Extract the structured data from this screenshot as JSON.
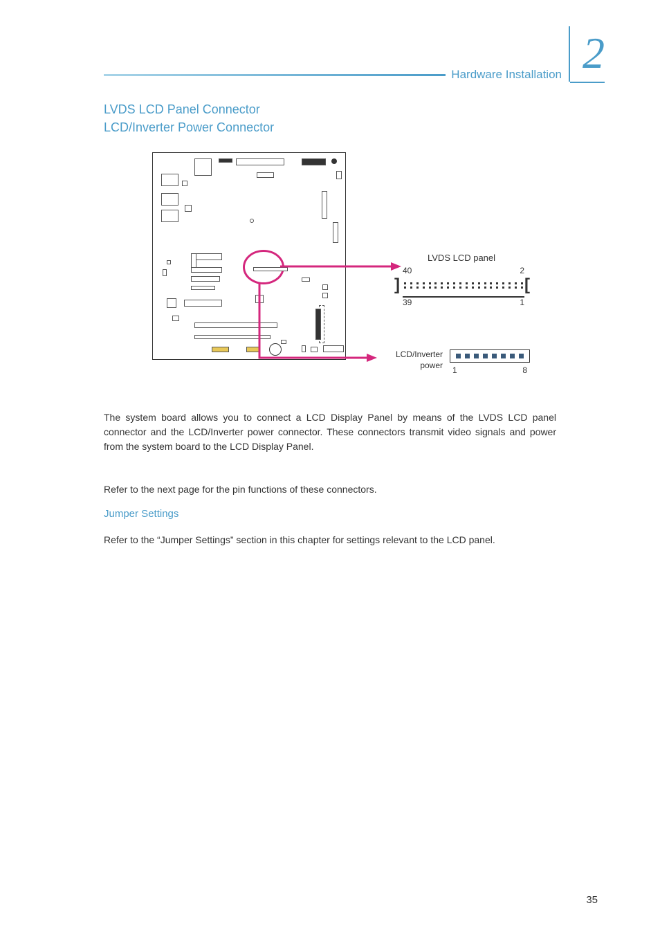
{
  "chapter": {
    "number": "2",
    "header_title": "Hardware Installation"
  },
  "section": {
    "title1": "LVDS LCD Panel Connector",
    "title2": "LCD/Inverter Power Connector"
  },
  "diagram": {
    "lvds_label": "LVDS LCD panel",
    "lvds_pin_top_left": "40",
    "lvds_pin_top_right": "2",
    "lvds_pin_bot_left": "39",
    "lvds_pin_bot_right": "1",
    "lcdinv_label_line1": "LCD/Inverter",
    "lcdinv_label_line2": "power",
    "lcdinv_pin_left": "1",
    "lcdinv_pin_right": "8"
  },
  "paragraphs": {
    "p1": "The system board allows you to connect a LCD Display Panel by means of the LVDS LCD panel connector and the LCD/Inverter power connector. These connectors transmit video signals and power from the system board to the LCD Display Panel.",
    "p2": "Refer to the next page for the pin functions of these connectors.",
    "subsection": "Jumper Settings",
    "p3": "Refer to the “Jumper Settings” section in this chapter for settings relevant to the LCD panel."
  },
  "page_number": "35"
}
